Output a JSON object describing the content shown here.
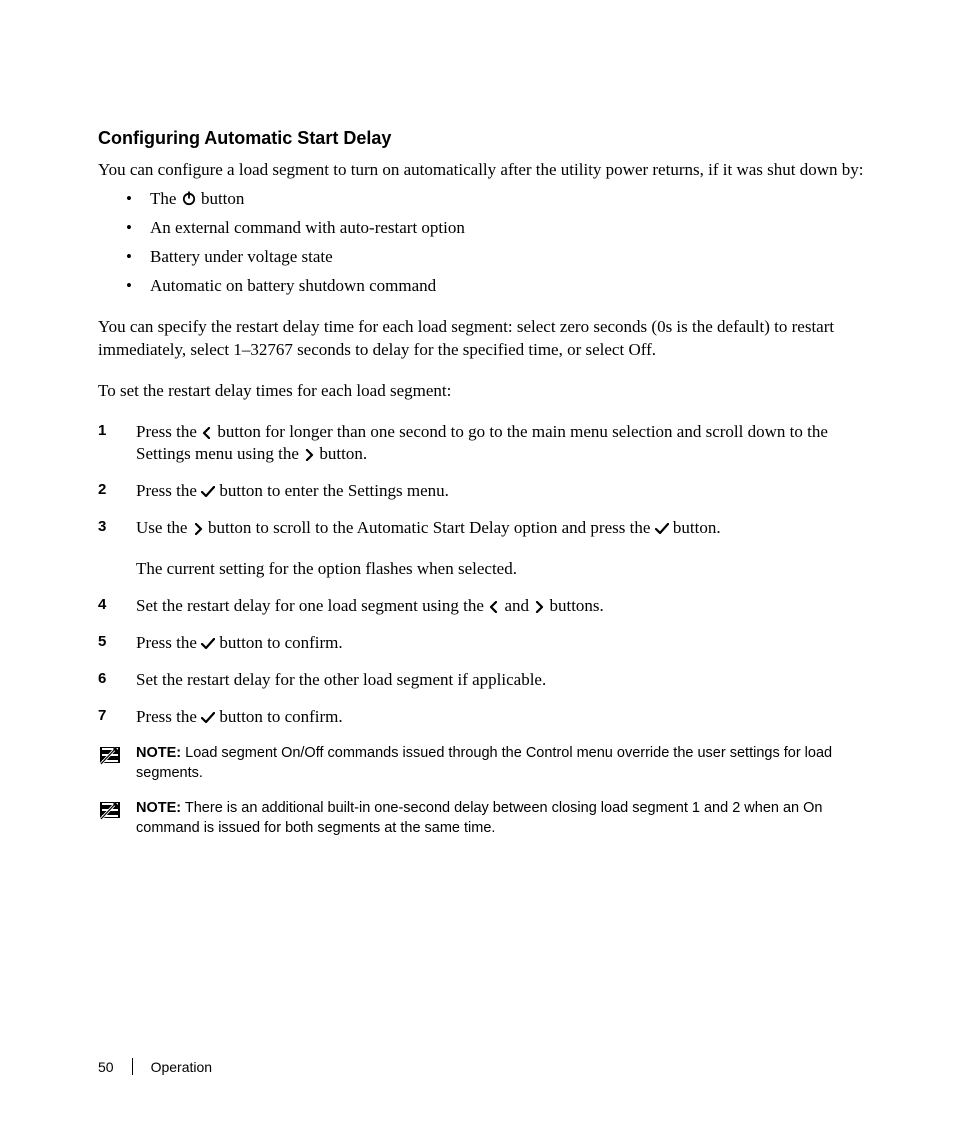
{
  "heading": "Configuring Automatic Start Delay",
  "intro": "You can configure a load segment to turn on automatically after the utility power returns, if it was shut down by:",
  "bullets": {
    "b1_prefix": "The ",
    "b1_suffix": " button",
    "b2": "An external command with auto-restart option",
    "b3": "Battery under voltage state",
    "b4": "Automatic on battery shutdown command"
  },
  "para1": "You can specify the restart delay time for each load segment: select zero seconds (0s is the default) to restart immediately, select 1–32767 seconds to delay for the specified time, or select Off.",
  "para2": "To set the restart delay times for each load segment:",
  "steps": {
    "s1a": "Press the ",
    "s1b": " button for longer than one second to go to the main menu selection and scroll down to the Settings menu using the ",
    "s1c": " button.",
    "s2a": "Press the ",
    "s2b": " button to enter the Settings menu.",
    "s3a": "Use the ",
    "s3b": " button to scroll to the Automatic Start Delay option and press the ",
    "s3c": " button.",
    "s3sub": "The current setting for the option flashes when selected.",
    "s4a": "Set the restart delay for one load segment using the ",
    "s4mid": " and ",
    "s4b": " buttons.",
    "s5a": "Press the ",
    "s5b": " button to confirm.",
    "s6": "Set the restart delay for the other load segment if applicable.",
    "s7a": "Press the ",
    "s7b": " button to confirm."
  },
  "notes": {
    "label": "NOTE:",
    "n1": " Load segment On/Off commands issued through the Control menu override the user settings for load segments.",
    "n2": " There is an additional built-in one-second delay between closing load segment 1 and 2 when an On command is issued for both segments at the same time."
  },
  "footer": {
    "page": "50",
    "section": "Operation"
  }
}
